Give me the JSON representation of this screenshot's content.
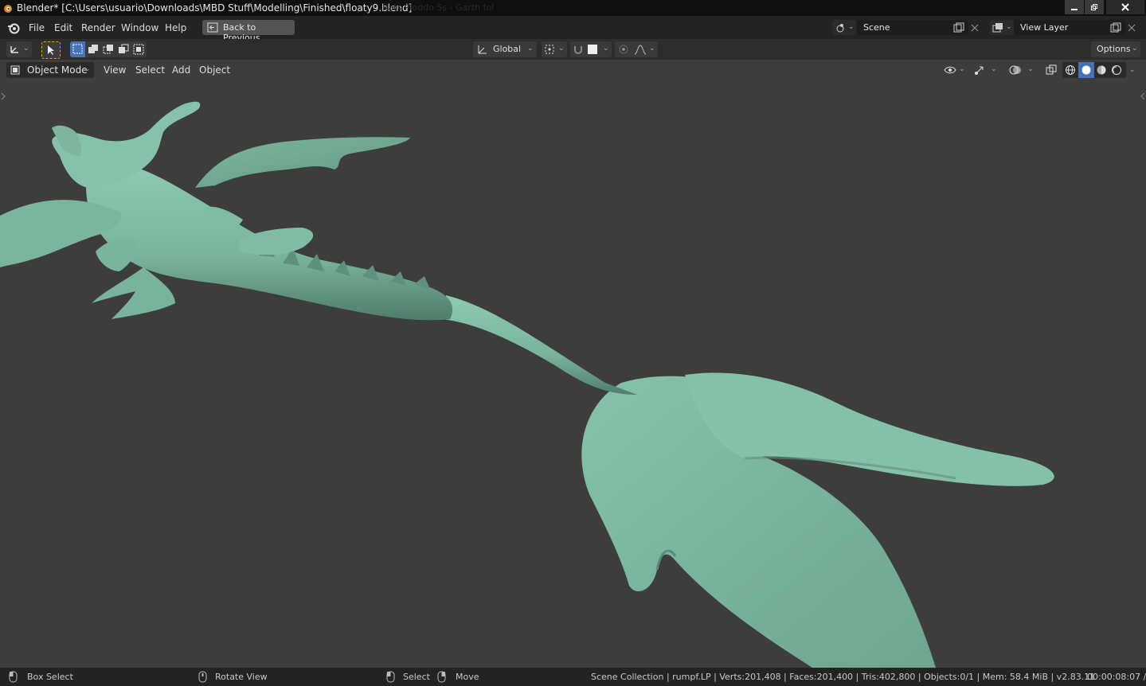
{
  "window": {
    "title": "Blender* [C:\\Users\\usuario\\Downloads\\MBD Stuff\\Modelling\\Finished\\floaty9.blend]",
    "ghost_text": "Rats Ploddo 5s - Garth fol",
    "minimize_icon": "minimize-icon",
    "maximize_icon": "restore-icon",
    "close_icon": "close-icon"
  },
  "menu": {
    "file": "File",
    "edit": "Edit",
    "render": "Render",
    "window": "Window",
    "help": "Help",
    "back_to_previous": "Back to Previous"
  },
  "scene": {
    "name": "Scene"
  },
  "view_layer": {
    "name": "View Layer"
  },
  "toolbar": {
    "transform_orientation": "Global",
    "options": "Options"
  },
  "header": {
    "mode": "Object Mode",
    "view": "View",
    "select": "Select",
    "add": "Add",
    "object": "Object"
  },
  "status": {
    "box_select": "Box Select",
    "rotate_view": "Rotate View",
    "select": "Select",
    "move": "Move",
    "stats": "Scene Collection | rumpf.LP | Verts:201,408 | Faces:201,400 | Tris:402,800 | Objects:0/1 | Mem: 58.4 MiB | v2.83.11",
    "time": "00:00:08:07 /"
  },
  "colors": {
    "mesh": "#7fb8a1",
    "viewport_bg": "#3d3d3d",
    "topbar": "#232323",
    "accent_blue": "#4772b3",
    "select_tool": "#e0a020"
  }
}
